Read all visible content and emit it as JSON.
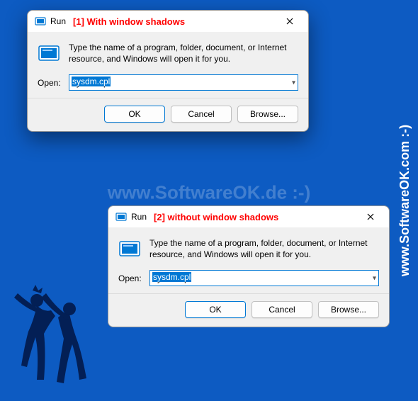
{
  "watermarks": {
    "center": "www.SoftwareOK.de :-)",
    "right": "www.SoftwareOK.com :-)"
  },
  "annotation1": "[1] With window shadows",
  "annotation2": "[2] without window shadows",
  "dialog": {
    "title": "Run",
    "description": "Type the name of a program, folder, document, or Internet resource, and Windows will open it for you.",
    "open_label": "Open:",
    "input_value": "sysdm.cpl",
    "ok": "OK",
    "cancel": "Cancel",
    "browse": "Browse..."
  }
}
